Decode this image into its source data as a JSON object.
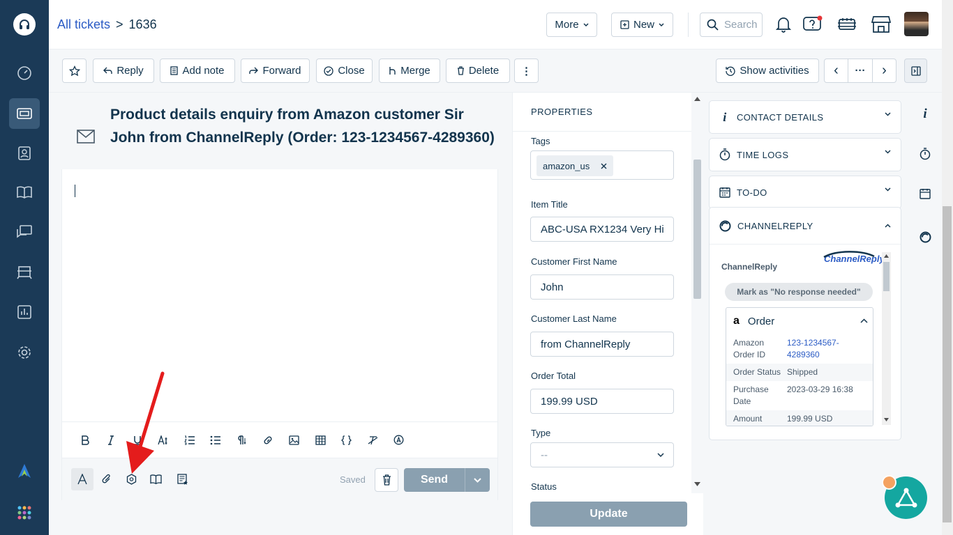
{
  "breadcrumb": {
    "root": "All tickets",
    "separator": ">",
    "ticket_id": "1636"
  },
  "topbar": {
    "more_label": "More",
    "new_label": "New",
    "search_placeholder": "Search"
  },
  "actions": {
    "reply": "Reply",
    "add_note": "Add note",
    "forward": "Forward",
    "close": "Close",
    "merge": "Merge",
    "delete": "Delete",
    "more": "⋮",
    "show_activities": "Show activities",
    "prev": "‹",
    "ellipsis": "···",
    "next": "›"
  },
  "ticket": {
    "subject": "Product details enquiry from Amazon customer Sir John from ChannelReply (Order: 123-1234567-4289360)"
  },
  "editor": {
    "saved_label": "Saved",
    "send_label": "Send"
  },
  "properties": {
    "header": "PROPERTIES",
    "tags_label": "Tags",
    "tags": [
      "amazon_us"
    ],
    "item_title_label": "Item Title",
    "item_title_value": "ABC-USA RX1234 Very Hi",
    "first_name_label": "Customer First Name",
    "first_name_value": "John",
    "last_name_label": "Customer Last Name",
    "last_name_value": "from ChannelReply",
    "order_total_label": "Order Total",
    "order_total_value": "199.99 USD",
    "type_label": "Type",
    "type_value": "--",
    "status_label": "Status",
    "update_label": "Update"
  },
  "right_panel": {
    "contact_details": "CONTACT DETAILS",
    "time_logs": "TIME LOGS",
    "todo": "TO-DO",
    "channelreply": "CHANNELREPLY",
    "cr_name": "ChannelReply",
    "cr_logo": "ChannelReply",
    "mark_label": "Mark as \"No response needed\"",
    "order": {
      "title": "Order",
      "amazon_icon": "a",
      "rows": [
        {
          "key": "Amazon Order ID",
          "value": "123-1234567-4289360"
        },
        {
          "key": "Order Status",
          "value": "Shipped"
        },
        {
          "key": "Purchase Date",
          "value": "2023-03-29 16:38"
        },
        {
          "key": "Amount",
          "value": "199.99 USD"
        }
      ]
    }
  },
  "colors": {
    "sidebar": "#1b3a57",
    "link": "#2c5cc5",
    "fab": "#14a7a0",
    "arrow": "#e41c1c"
  }
}
